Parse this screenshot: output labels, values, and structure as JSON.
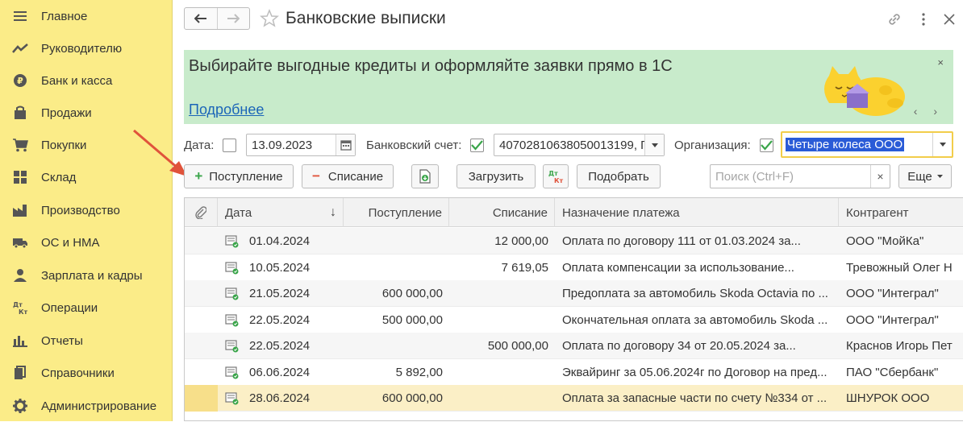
{
  "sidebar": {
    "items": [
      {
        "label": "Главное",
        "icon": "menu-icon"
      },
      {
        "label": "Руководителю",
        "icon": "trend-icon"
      },
      {
        "label": "Банк и касса",
        "icon": "coin-icon"
      },
      {
        "label": "Продажи",
        "icon": "bag-icon"
      },
      {
        "label": "Покупки",
        "icon": "cart-icon"
      },
      {
        "label": "Склад",
        "icon": "warehouse-icon"
      },
      {
        "label": "Производство",
        "icon": "factory-icon"
      },
      {
        "label": "ОС и НМА",
        "icon": "truck-icon"
      },
      {
        "label": "Зарплата и кадры",
        "icon": "person-icon"
      },
      {
        "label": "Операции",
        "icon": "dt-kt-icon"
      },
      {
        "label": "Отчеты",
        "icon": "bar-chart-icon"
      },
      {
        "label": "Справочники",
        "icon": "books-icon"
      },
      {
        "label": "Администрирование",
        "icon": "gear-icon"
      }
    ]
  },
  "header": {
    "title": "Банковские выписки"
  },
  "banner": {
    "text": "Выбирайте выгодные кредиты и оформляйте заявки прямо в 1С",
    "link": "Подробнее",
    "close": "×",
    "nav": "‹ ›"
  },
  "filters": {
    "date_label": "Дата:",
    "date_value": "13.09.2023",
    "account_label": "Банковский счет:",
    "account_value": "40702810638050013199, П",
    "org_label": "Организация:",
    "org_value": "Четыре колеса ООО"
  },
  "toolbar": {
    "receipt": "Поступление",
    "writeoff": "Списание",
    "load": "Загрузить",
    "dtkt": "Дт Кт",
    "select": "Подобрать",
    "search_placeholder": "Поиск (Ctrl+F)",
    "search_clear": "×",
    "more": "Еще"
  },
  "table": {
    "columns": [
      "Дата",
      "Поступление",
      "Списание",
      "Назначение платежа",
      "Контрагент"
    ],
    "sort_indicator": "↓",
    "rows": [
      {
        "date": "01.04.2024",
        "in": "",
        "out": "12 000,00",
        "purpose": "Оплата по договору 111 от 01.03.2024 за...",
        "counterparty": "ООО \"МойКа\""
      },
      {
        "date": "10.05.2024",
        "in": "",
        "out": "7 619,05",
        "purpose": "Оплата компенсации за использование...",
        "counterparty": "Тревожный Олег Н"
      },
      {
        "date": "21.05.2024",
        "in": "600 000,00",
        "out": "",
        "purpose": "Предоплата за автомобиль Skoda Octavia по ...",
        "counterparty": "ООО \"Интеграл\""
      },
      {
        "date": "22.05.2024",
        "in": "500 000,00",
        "out": "",
        "purpose": "Окончательная оплата за автомобиль Skoda ...",
        "counterparty": "ООО \"Интеграл\""
      },
      {
        "date": "22.05.2024",
        "in": "",
        "out": "500 000,00",
        "purpose": "Оплата по договору 34 от 20.05.2024 за...",
        "counterparty": "Краснов Игорь Пет"
      },
      {
        "date": "06.06.2024",
        "in": "5 892,00",
        "out": "",
        "purpose": "Эквайринг за 05.06.2024г по Договор на пред...",
        "counterparty": "ПАО \"Сбербанк\""
      },
      {
        "date": "28.06.2024",
        "in": "600 000,00",
        "out": "",
        "purpose": "Оплата за запасные части по счету №334 от ...",
        "counterparty": "ШНУРОК ООО"
      }
    ]
  },
  "colors": {
    "sidebar_bg": "#fbec88",
    "banner_bg": "#c8ebcb",
    "link": "#1b65b8",
    "check_green": "#3aa54a",
    "selected_row": "#fbefc6",
    "arrow": "#e0533b"
  }
}
